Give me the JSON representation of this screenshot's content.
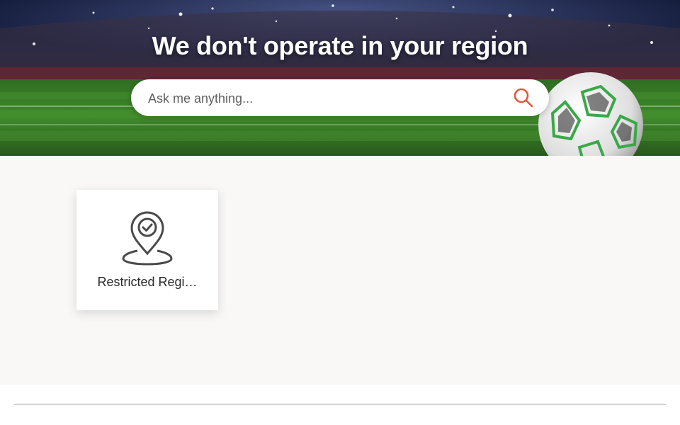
{
  "hero": {
    "title": "We don't operate in your region",
    "search": {
      "placeholder": "Ask me anything..."
    }
  },
  "categories": [
    {
      "label": "Restricted Regi…",
      "icon": "location-check-icon"
    }
  ],
  "colors": {
    "accent": "#e8553a",
    "content_background": "#f9f8f7",
    "grass": "#3f8a2a",
    "card_background": "#ffffff"
  },
  "icons": {
    "search": "search-icon",
    "decor": "soccer-ball-icon"
  }
}
